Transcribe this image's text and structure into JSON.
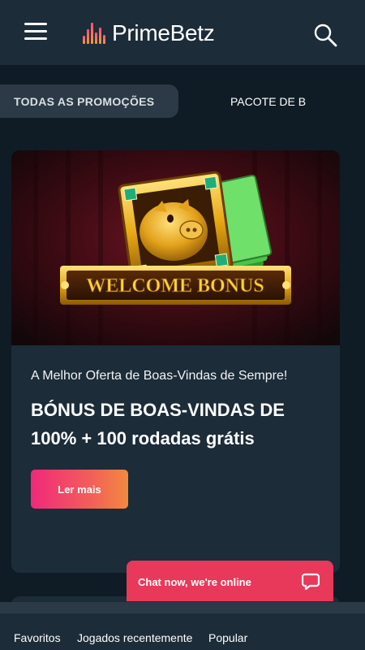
{
  "header": {
    "logo_text": "PrimeBetz",
    "icons": [
      "menu-icon",
      "search-icon"
    ]
  },
  "tabs": [
    {
      "label": "TODAS AS PROMOÇÕES",
      "active": true
    },
    {
      "label": "PACOTE DE B",
      "active": false
    }
  ],
  "promo": {
    "banner_text": "WELCOME BONUS",
    "subtitle": "A Melhor Oferta de Boas-Vindas de Sempre!",
    "headline": "BÓNUS DE BOAS-VINDAS DE 100% + 100 rodadas grátis",
    "cta_label": "Ler mais"
  },
  "chat": {
    "label": "Chat now, we're online",
    "icon": "chat-bubble-icon"
  },
  "bottom_nav": [
    "Favoritos",
    "Jogados recentemente",
    "Popular"
  ],
  "colors": {
    "background": "#0f1c25",
    "panel": "#1c2c38",
    "accent_pink": "#f0297a",
    "accent_orange": "#f3893e",
    "chat_red": "#e8395a"
  }
}
